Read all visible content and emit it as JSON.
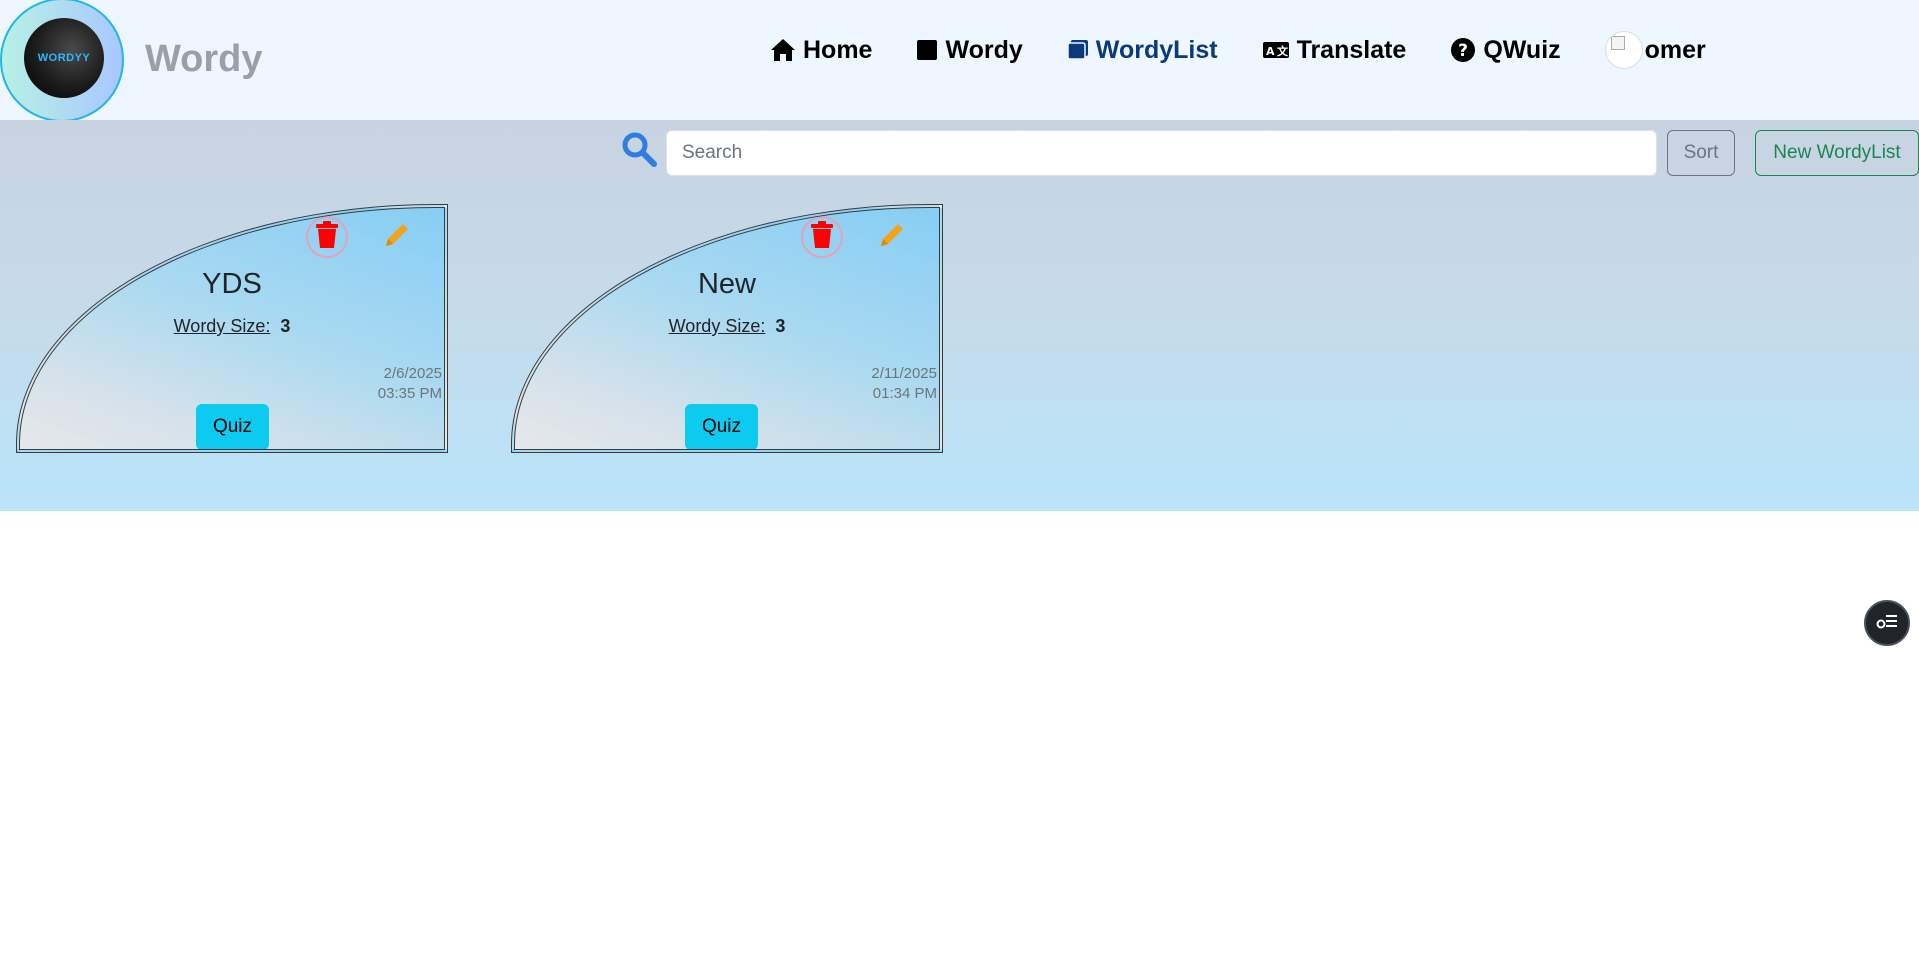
{
  "brand": {
    "logo_text": "WORDYY",
    "name": "Wordy"
  },
  "nav": {
    "items": [
      {
        "label": "Home",
        "icon": "home-icon"
      },
      {
        "label": "Wordy",
        "icon": "square-icon"
      },
      {
        "label": "WordyList",
        "icon": "list-card-icon",
        "active": true
      },
      {
        "label": "Translate",
        "icon": "translate-icon"
      },
      {
        "label": "QWuiz",
        "icon": "question-circle-icon"
      }
    ],
    "user": {
      "label": "omer",
      "icon": "avatar"
    }
  },
  "toolbar": {
    "search_placeholder": "Search",
    "sort_label": "Sort",
    "new_label": "New WordyList"
  },
  "cards": [
    {
      "title": "YDS",
      "size_label": "Wordy Size:",
      "size_value": "3",
      "date": "2/6/2025",
      "time": "03:35 PM",
      "quiz_label": "Quiz"
    },
    {
      "title": "New",
      "size_label": "Wordy Size:",
      "size_value": "3",
      "date": "2/11/2025",
      "time": "01:34 PM",
      "quiz_label": "Quiz"
    }
  ],
  "colors": {
    "nav_bg": "#eef6ff",
    "active_nav": "#0b3a7a",
    "quiz_button": "#0dcaf0",
    "new_button": "#198754",
    "trash_icon": "#ff0000",
    "edit_icon": "#f5a21b"
  }
}
